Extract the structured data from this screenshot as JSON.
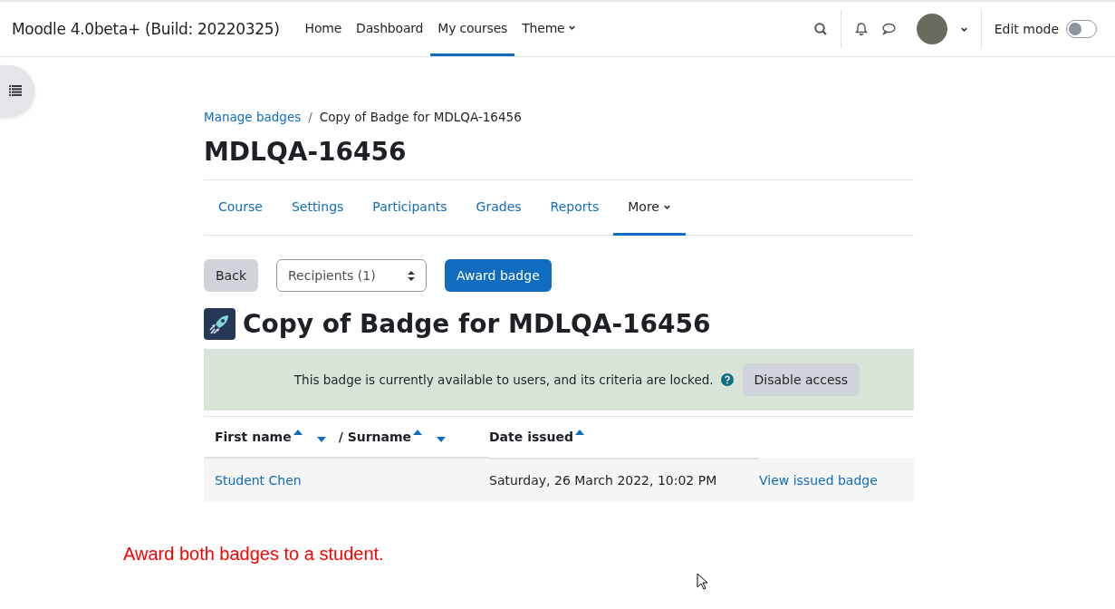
{
  "header": {
    "site_name": "Moodle 4.0beta+ (Build: 20220325)",
    "nav": [
      {
        "label": "Home",
        "selected": false,
        "dropdown": false
      },
      {
        "label": "Dashboard",
        "selected": false,
        "dropdown": false
      },
      {
        "label": "My courses",
        "selected": true,
        "dropdown": false
      },
      {
        "label": "Theme",
        "selected": false,
        "dropdown": true
      }
    ],
    "edit_mode": {
      "label": "Edit mode",
      "on": false
    }
  },
  "breadcrumb_separator": "/",
  "breadcrumb": [
    {
      "label": "Manage badges",
      "link": true
    },
    {
      "label": "Copy of Badge for MDLQA-16456",
      "link": false
    }
  ],
  "course_title": "MDLQA-16456",
  "tabs": [
    {
      "label": "Course",
      "selected": false,
      "dropdown": false
    },
    {
      "label": "Settings",
      "selected": false,
      "dropdown": false
    },
    {
      "label": "Participants",
      "selected": false,
      "dropdown": false
    },
    {
      "label": "Grades",
      "selected": false,
      "dropdown": false
    },
    {
      "label": "Reports",
      "selected": false,
      "dropdown": false
    },
    {
      "label": "More",
      "selected": true,
      "dropdown": true
    }
  ],
  "actions": {
    "back": "Back",
    "select": "Recipients (1)",
    "award": "Award badge"
  },
  "badge_title": "Copy of Badge for MDLQA-16456",
  "notice": {
    "text": "This badge is currently available to users, and its criteria are locked.",
    "button": "Disable access"
  },
  "table": {
    "columns": [
      "First name",
      "/ Surname",
      "Date issued"
    ],
    "rows": [
      {
        "name": "Student Chen",
        "date": "Saturday, 26 March 2022, 10:02 PM",
        "action": "View issued badge"
      }
    ]
  },
  "caption": "Award both badges to a student."
}
